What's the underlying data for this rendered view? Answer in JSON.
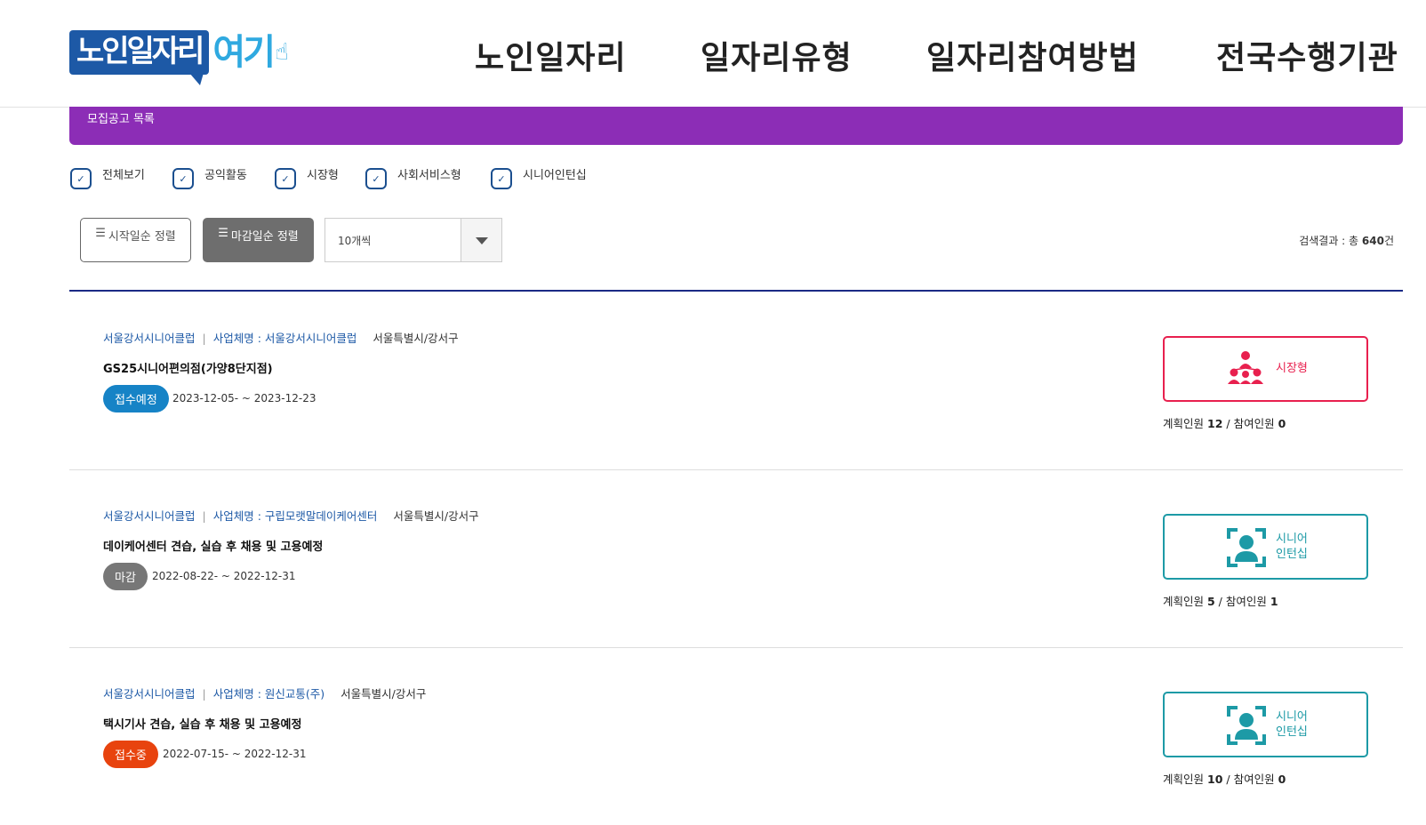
{
  "logo": {
    "main": "노인일자리",
    "sub": "여기",
    "hand": "☝"
  },
  "nav": [
    "노인일자리",
    "일자리유형",
    "일자리참여방법",
    "전국수행기관"
  ],
  "section_bar": "모집공고 목록",
  "filters": [
    "전체보기",
    "공익활동",
    "시장형",
    "사회서비스형",
    "시니어인턴십"
  ],
  "sort": {
    "start": "시작일순 정렬",
    "end": "마감일순 정렬",
    "icon": "☰"
  },
  "page_size": {
    "value": "10개씩"
  },
  "result": {
    "prefix": "검색결과 : 총 ",
    "count": "640",
    "suffix": "건"
  },
  "listings": [
    {
      "org": "서울강서시니어클럽",
      "company": "사업체명 : 서울강서시니어클럽",
      "region": "서울특별시/강서구",
      "title": "GS25시니어편의점(가양8단지점)",
      "status": "접수예정",
      "status_color": "#1683c6",
      "dates": "2023-12-05- ~ 2023-12-23",
      "type": "시장형",
      "type_color": "#e8204e",
      "planned_label": "계획인원",
      "planned": "12",
      "joined_label": "참여인원",
      "joined": "0"
    },
    {
      "org": "서울강서시니어클럽",
      "company": "사업체명 : 구립모랫말데이케어센터",
      "region": "서울특별시/강서구",
      "title": "데이케어센터 견습, 실습 후 채용 및 고용예정",
      "status": "마감",
      "status_color": "#777777",
      "dates": "2022-08-22- ~ 2022-12-31",
      "type": "시니어 인턴십",
      "type_line1": "시니어",
      "type_line2": "인턴십",
      "type_color": "#1d9aa6",
      "planned_label": "계획인원",
      "planned": "5",
      "joined_label": "참여인원",
      "joined": "1"
    },
    {
      "org": "서울강서시니어클럽",
      "company": "사업체명 : 원신교통(주)",
      "region": "서울특별시/강서구",
      "title": "택시기사 견습, 실습 후 채용 및 고용예정",
      "status": "접수중",
      "status_color": "#e8430e",
      "dates": "2022-07-15- ~ 2022-12-31",
      "type": "시니어 인턴십",
      "type_line1": "시니어",
      "type_line2": "인턴십",
      "type_color": "#1d9aa6",
      "planned_label": "계획인원",
      "planned": "10",
      "joined_label": "참여인원",
      "joined": "0"
    }
  ],
  "icons": {
    "check": "check-icon",
    "market": "people-network-icon",
    "intern": "person-frame-icon"
  }
}
